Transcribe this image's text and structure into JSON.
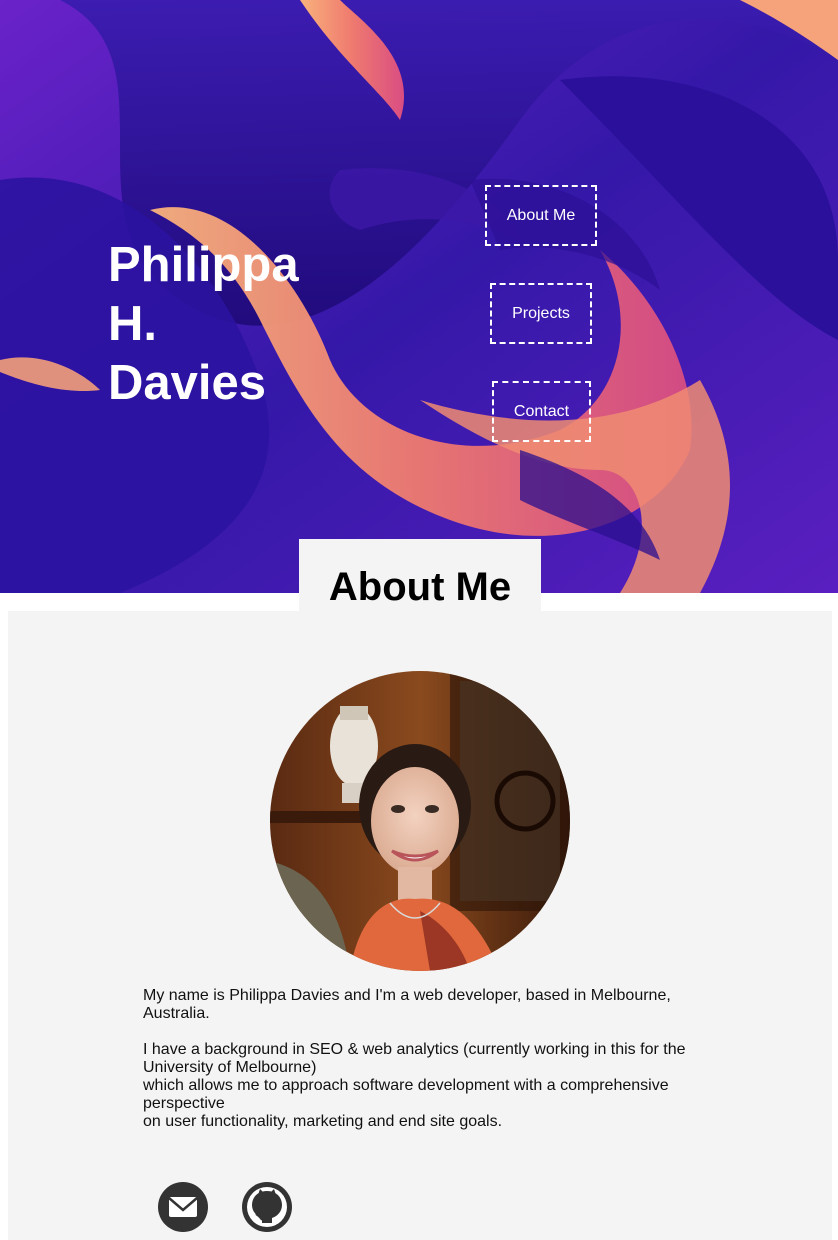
{
  "hero": {
    "name_lines": [
      "Philippa",
      "H.",
      "Davies"
    ],
    "nav": {
      "about": "About Me",
      "projects": "Projects",
      "contact": "Contact"
    },
    "colors": {
      "deep": "#2a0f8f",
      "violet": "#5b1fc4",
      "peach": "#f6a27a",
      "coral": "#ec6a70"
    }
  },
  "about": {
    "title": "About Me",
    "avatar_icon": "profile-photo",
    "bio": {
      "p1": [
        "My name is Philippa Davies and I'm a web developer, based in Melbourne,",
        "Australia."
      ],
      "p2": [
        "I have a background in SEO & web analytics (currently working in this for the",
        "University of Melbourne)",
        "which allows me to approach software development with a comprehensive",
        "perspective",
        "on user functionality, marketing and end site goals."
      ]
    },
    "social": {
      "email_icon": "mail-icon",
      "github_icon": "github-icon"
    }
  }
}
